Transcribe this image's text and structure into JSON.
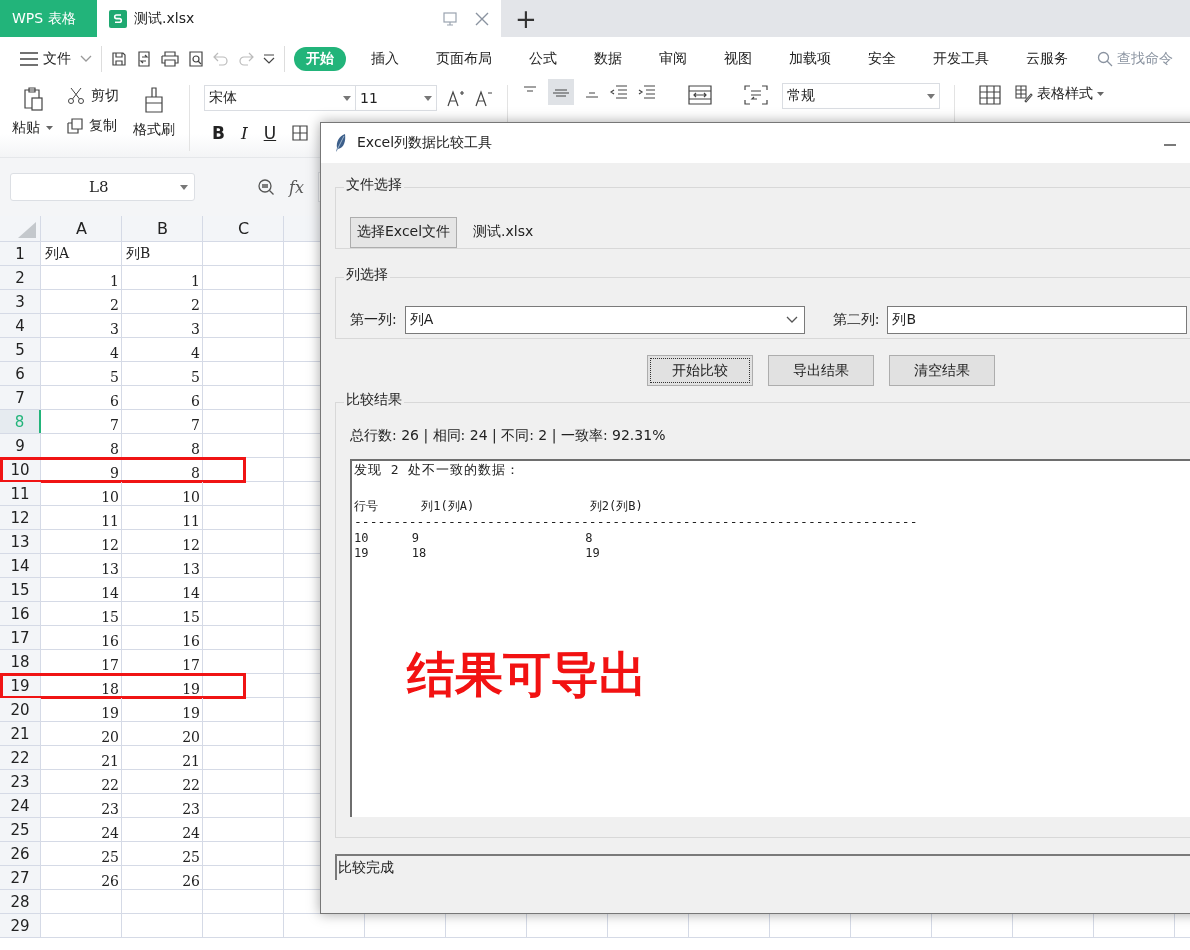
{
  "app_tabs": [
    {
      "label": "WPS 表格",
      "kind": "home",
      "selected": false
    },
    {
      "label": "测试.xlsx",
      "kind": "doc",
      "selected": true
    }
  ],
  "new_tab": "+",
  "menu": {
    "file": "文件",
    "tabs": [
      {
        "label": "开始",
        "selected": true
      },
      {
        "label": "插入",
        "selected": false
      },
      {
        "label": "页面布局",
        "selected": false
      },
      {
        "label": "公式",
        "selected": false
      },
      {
        "label": "数据",
        "selected": false
      },
      {
        "label": "审阅",
        "selected": false
      },
      {
        "label": "视图",
        "selected": false
      },
      {
        "label": "加载项",
        "selected": false
      },
      {
        "label": "安全",
        "selected": false
      },
      {
        "label": "开发工具",
        "selected": false
      },
      {
        "label": "云服务",
        "selected": false
      }
    ],
    "search_placeholder": "查找命令"
  },
  "ribbon": {
    "paste": "粘贴",
    "cut": "剪切",
    "copy": "复制",
    "format_painter": "格式刷",
    "font": "宋体",
    "size": "11",
    "format_buttons": [
      "B",
      "I",
      "U"
    ],
    "number_format": "常规",
    "table_style": "表格样式"
  },
  "formula_bar": {
    "cell_ref": "L8",
    "fx": "fx"
  },
  "sheet": {
    "columns": [
      "A",
      "B",
      "C"
    ],
    "rows": [
      {
        "number": "1",
        "kind": "text",
        "cells": [
          "列A",
          "列B"
        ],
        "selected": false,
        "highlighted": false
      },
      {
        "number": "2",
        "kind": "number",
        "cells": [
          "1",
          "1"
        ],
        "selected": false,
        "highlighted": false
      },
      {
        "number": "3",
        "kind": "number",
        "cells": [
          "2",
          "2"
        ],
        "selected": false,
        "highlighted": false
      },
      {
        "number": "4",
        "kind": "number",
        "cells": [
          "3",
          "3"
        ],
        "selected": false,
        "highlighted": false
      },
      {
        "number": "5",
        "kind": "number",
        "cells": [
          "4",
          "4"
        ],
        "selected": false,
        "highlighted": false
      },
      {
        "number": "6",
        "kind": "number",
        "cells": [
          "5",
          "5"
        ],
        "selected": false,
        "highlighted": false
      },
      {
        "number": "7",
        "kind": "number",
        "cells": [
          "6",
          "6"
        ],
        "selected": false,
        "highlighted": false
      },
      {
        "number": "8",
        "kind": "number",
        "cells": [
          "7",
          "7"
        ],
        "selected": true,
        "highlighted": false
      },
      {
        "number": "9",
        "kind": "number",
        "cells": [
          "8",
          "8"
        ],
        "selected": false,
        "highlighted": false
      },
      {
        "number": "10",
        "kind": "number",
        "cells": [
          "9",
          "8"
        ],
        "selected": false,
        "highlighted": true
      },
      {
        "number": "11",
        "kind": "number",
        "cells": [
          "10",
          "10"
        ],
        "selected": false,
        "highlighted": false
      },
      {
        "number": "12",
        "kind": "number",
        "cells": [
          "11",
          "11"
        ],
        "selected": false,
        "highlighted": false
      },
      {
        "number": "13",
        "kind": "number",
        "cells": [
          "12",
          "12"
        ],
        "selected": false,
        "highlighted": false
      },
      {
        "number": "14",
        "kind": "number",
        "cells": [
          "13",
          "13"
        ],
        "selected": false,
        "highlighted": false
      },
      {
        "number": "15",
        "kind": "number",
        "cells": [
          "14",
          "14"
        ],
        "selected": false,
        "highlighted": false
      },
      {
        "number": "16",
        "kind": "number",
        "cells": [
          "15",
          "15"
        ],
        "selected": false,
        "highlighted": false
      },
      {
        "number": "17",
        "kind": "number",
        "cells": [
          "16",
          "16"
        ],
        "selected": false,
        "highlighted": false
      },
      {
        "number": "18",
        "kind": "number",
        "cells": [
          "17",
          "17"
        ],
        "selected": false,
        "highlighted": false
      },
      {
        "number": "19",
        "kind": "number",
        "cells": [
          "18",
          "19"
        ],
        "selected": false,
        "highlighted": true
      },
      {
        "number": "20",
        "kind": "number",
        "cells": [
          "19",
          "19"
        ],
        "selected": false,
        "highlighted": false
      },
      {
        "number": "21",
        "kind": "number",
        "cells": [
          "20",
          "20"
        ],
        "selected": false,
        "highlighted": false
      },
      {
        "number": "22",
        "kind": "number",
        "cells": [
          "21",
          "21"
        ],
        "selected": false,
        "highlighted": false
      },
      {
        "number": "23",
        "kind": "number",
        "cells": [
          "22",
          "22"
        ],
        "selected": false,
        "highlighted": false
      },
      {
        "number": "24",
        "kind": "number",
        "cells": [
          "23",
          "23"
        ],
        "selected": false,
        "highlighted": false
      },
      {
        "number": "25",
        "kind": "number",
        "cells": [
          "24",
          "24"
        ],
        "selected": false,
        "highlighted": false
      },
      {
        "number": "26",
        "kind": "number",
        "cells": [
          "25",
          "25"
        ],
        "selected": false,
        "highlighted": false
      },
      {
        "number": "27",
        "kind": "number",
        "cells": [
          "26",
          "26"
        ],
        "selected": false,
        "highlighted": false
      },
      {
        "number": "28",
        "kind": "number",
        "cells": [],
        "selected": false,
        "highlighted": false
      },
      {
        "number": "29",
        "kind": "number",
        "cells": [],
        "selected": false,
        "highlighted": false
      }
    ]
  },
  "dialog": {
    "title": "Excel列数据比较工具",
    "file_section": {
      "legend": "文件选择",
      "button": "选择Excel文件",
      "filename": "测试.xlsx"
    },
    "column_section": {
      "legend": "列选择",
      "first_label": "第一列:",
      "first_value": "列A",
      "second_label": "第二列:",
      "second_value": "列B"
    },
    "buttons": [
      {
        "label": "开始比较",
        "focused": true
      },
      {
        "label": "导出结果",
        "focused": false
      },
      {
        "label": "清空结果",
        "focused": false
      }
    ],
    "results": {
      "legend": "比较结果",
      "summary": "总行数: 26 | 相同: 24 | 不同: 2 | 一致率: 92.31%",
      "lines": [
        "发现 2 处不一致的数据：",
        "行号      列1(列A)                列2(列B)",
        "------------------------------------------------------------------------",
        "10      9                       8",
        "19      18                      19"
      ],
      "annotation": "结果可导出"
    },
    "status": "比较完成"
  }
}
